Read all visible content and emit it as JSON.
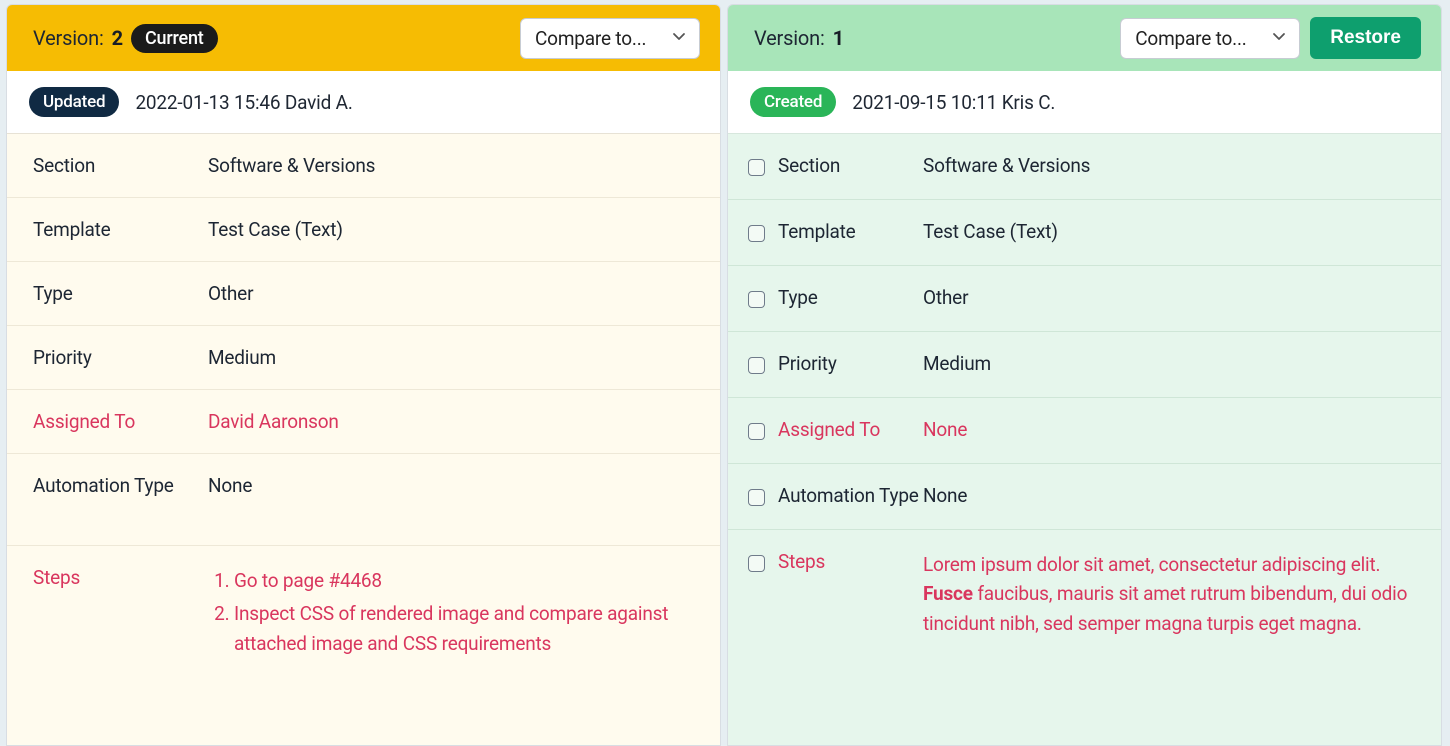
{
  "left": {
    "version_label": "Version:",
    "version_number": "2",
    "current_pill": "Current",
    "compare_label": "Compare to...",
    "status_badge": "Updated",
    "meta_text": "2022-01-13 15:46 David A.",
    "fields": {
      "section": {
        "label": "Section",
        "value": "Software & Versions",
        "diff": false
      },
      "template": {
        "label": "Template",
        "value": "Test Case (Text)",
        "diff": false
      },
      "type": {
        "label": "Type",
        "value": "Other",
        "diff": false
      },
      "priority": {
        "label": "Priority",
        "value": "Medium",
        "diff": false
      },
      "assigned_to": {
        "label": "Assigned To",
        "value": "David Aaronson",
        "diff": true
      },
      "automation_type": {
        "label": "Automation Type",
        "value": "None",
        "diff": false
      },
      "steps": {
        "label": "Steps",
        "diff": true,
        "items": [
          "Go to page #4468",
          "Inspect CSS of rendered image and compare against attached image and CSS requirements"
        ]
      }
    }
  },
  "right": {
    "version_label": "Version:",
    "version_number": "1",
    "compare_label": "Compare to...",
    "restore_label": "Restore",
    "status_badge": "Created",
    "meta_text": "2021-09-15 10:11 Kris C.",
    "fields": {
      "section": {
        "label": "Section",
        "value": "Software & Versions",
        "diff": false
      },
      "template": {
        "label": "Template",
        "value": "Test Case (Text)",
        "diff": false
      },
      "type": {
        "label": "Type",
        "value": "Other",
        "diff": false
      },
      "priority": {
        "label": "Priority",
        "value": "Medium",
        "diff": false
      },
      "assigned_to": {
        "label": "Assigned To",
        "value": "None",
        "diff": true
      },
      "automation_type": {
        "label": "Automation Type",
        "value": "None",
        "diff": false
      },
      "steps": {
        "label": "Steps",
        "diff": true,
        "lorem_pre": "Lorem ipsum dolor sit amet, consectetur adipiscing elit. ",
        "lorem_bold": "Fusce",
        "lorem_post": " faucibus, mauris sit amet rutrum bibendum, dui odio tincidunt nibh, sed semper magna turpis eget magna."
      }
    }
  }
}
